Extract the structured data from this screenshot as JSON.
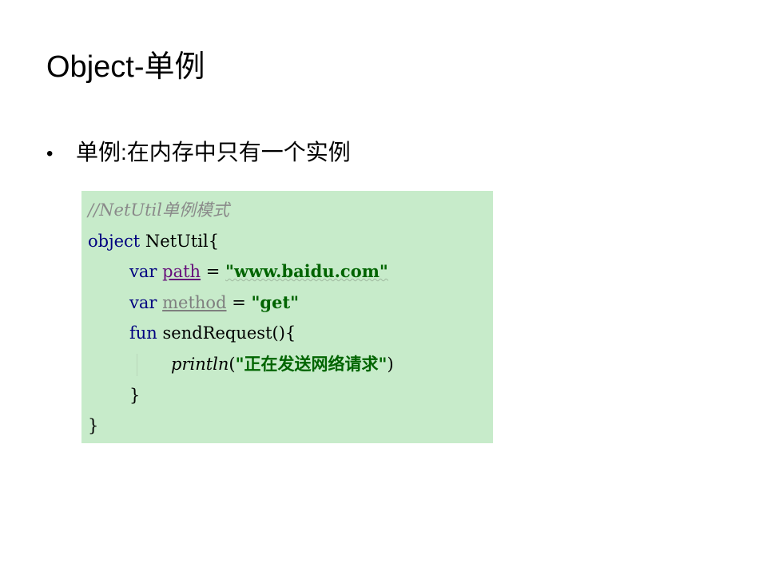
{
  "slide": {
    "title": "Object-单例",
    "bullet_symbol": "•",
    "bullet_text": "单例:在内存中只有一个实例"
  },
  "code": {
    "comment": "//NetUtil单例模式",
    "line2_kw": "object",
    "line2_rest": " NetUtil{",
    "line3_kw": "var",
    "line3_field": "path",
    "line3_eq": " = ",
    "line3_str": "\"www.baidu.com\"",
    "line4_kw": "var",
    "line4_field": "method",
    "line4_eq": " = ",
    "line4_str": "\"get\"",
    "line5_kw": "fun",
    "line5_rest": " sendRequest(){",
    "line6_fn": "println",
    "line6_open": "(",
    "line6_str": "\"正在发送网络请求\"",
    "line6_close": ")",
    "line7": "}",
    "line8": "}"
  },
  "colors": {
    "code_background": "#c7ebca",
    "keyword": "#000080",
    "string": "#006400",
    "comment": "#8a8a8a"
  }
}
